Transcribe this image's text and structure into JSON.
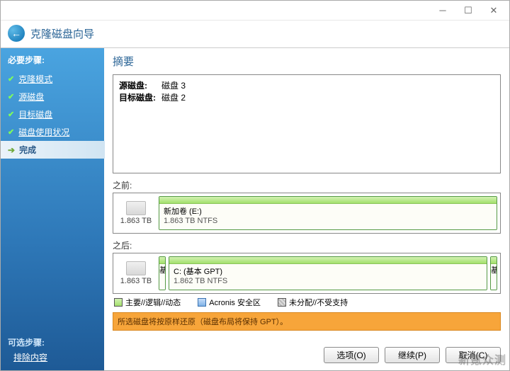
{
  "window": {
    "title": "克隆磁盘向导"
  },
  "sidebar": {
    "required_heading": "必要步骤:",
    "steps": [
      {
        "label": "克隆模式",
        "done": true
      },
      {
        "label": "源磁盘",
        "done": true
      },
      {
        "label": "目标磁盘",
        "done": true
      },
      {
        "label": "磁盘使用状况",
        "done": true
      }
    ],
    "current_step": "完成",
    "optional_heading": "可选步骤:",
    "optional_link": "排除内容"
  },
  "main": {
    "title": "摘要",
    "source_label": "源磁盘:",
    "source_value": "磁盘 3",
    "target_label": "目标磁盘:",
    "target_value": "磁盘 2",
    "before_label": "之前:",
    "after_label": "之后:",
    "before_disk": {
      "size": "1.863 TB",
      "partition": {
        "name": "新加卷 (E:)",
        "detail": "1.863 TB NTFS"
      }
    },
    "after_disk": {
      "size": "1.863 TB",
      "small1": "基",
      "partition": {
        "name": "C: (基本 GPT)",
        "detail": "1.862 TB  NTFS"
      },
      "small2": "基"
    },
    "legend": {
      "primary": "主要//逻辑//动态",
      "acronis": "Acronis 安全区",
      "unalloc": "未分配//不受支持"
    },
    "notice": "所选磁盘将按原样还原（磁盘布局将保持 GPT）。"
  },
  "footer": {
    "options": "选项(O)",
    "continue": "继续(P)",
    "cancel": "取消(C)"
  },
  "watermark": "新氪众测"
}
